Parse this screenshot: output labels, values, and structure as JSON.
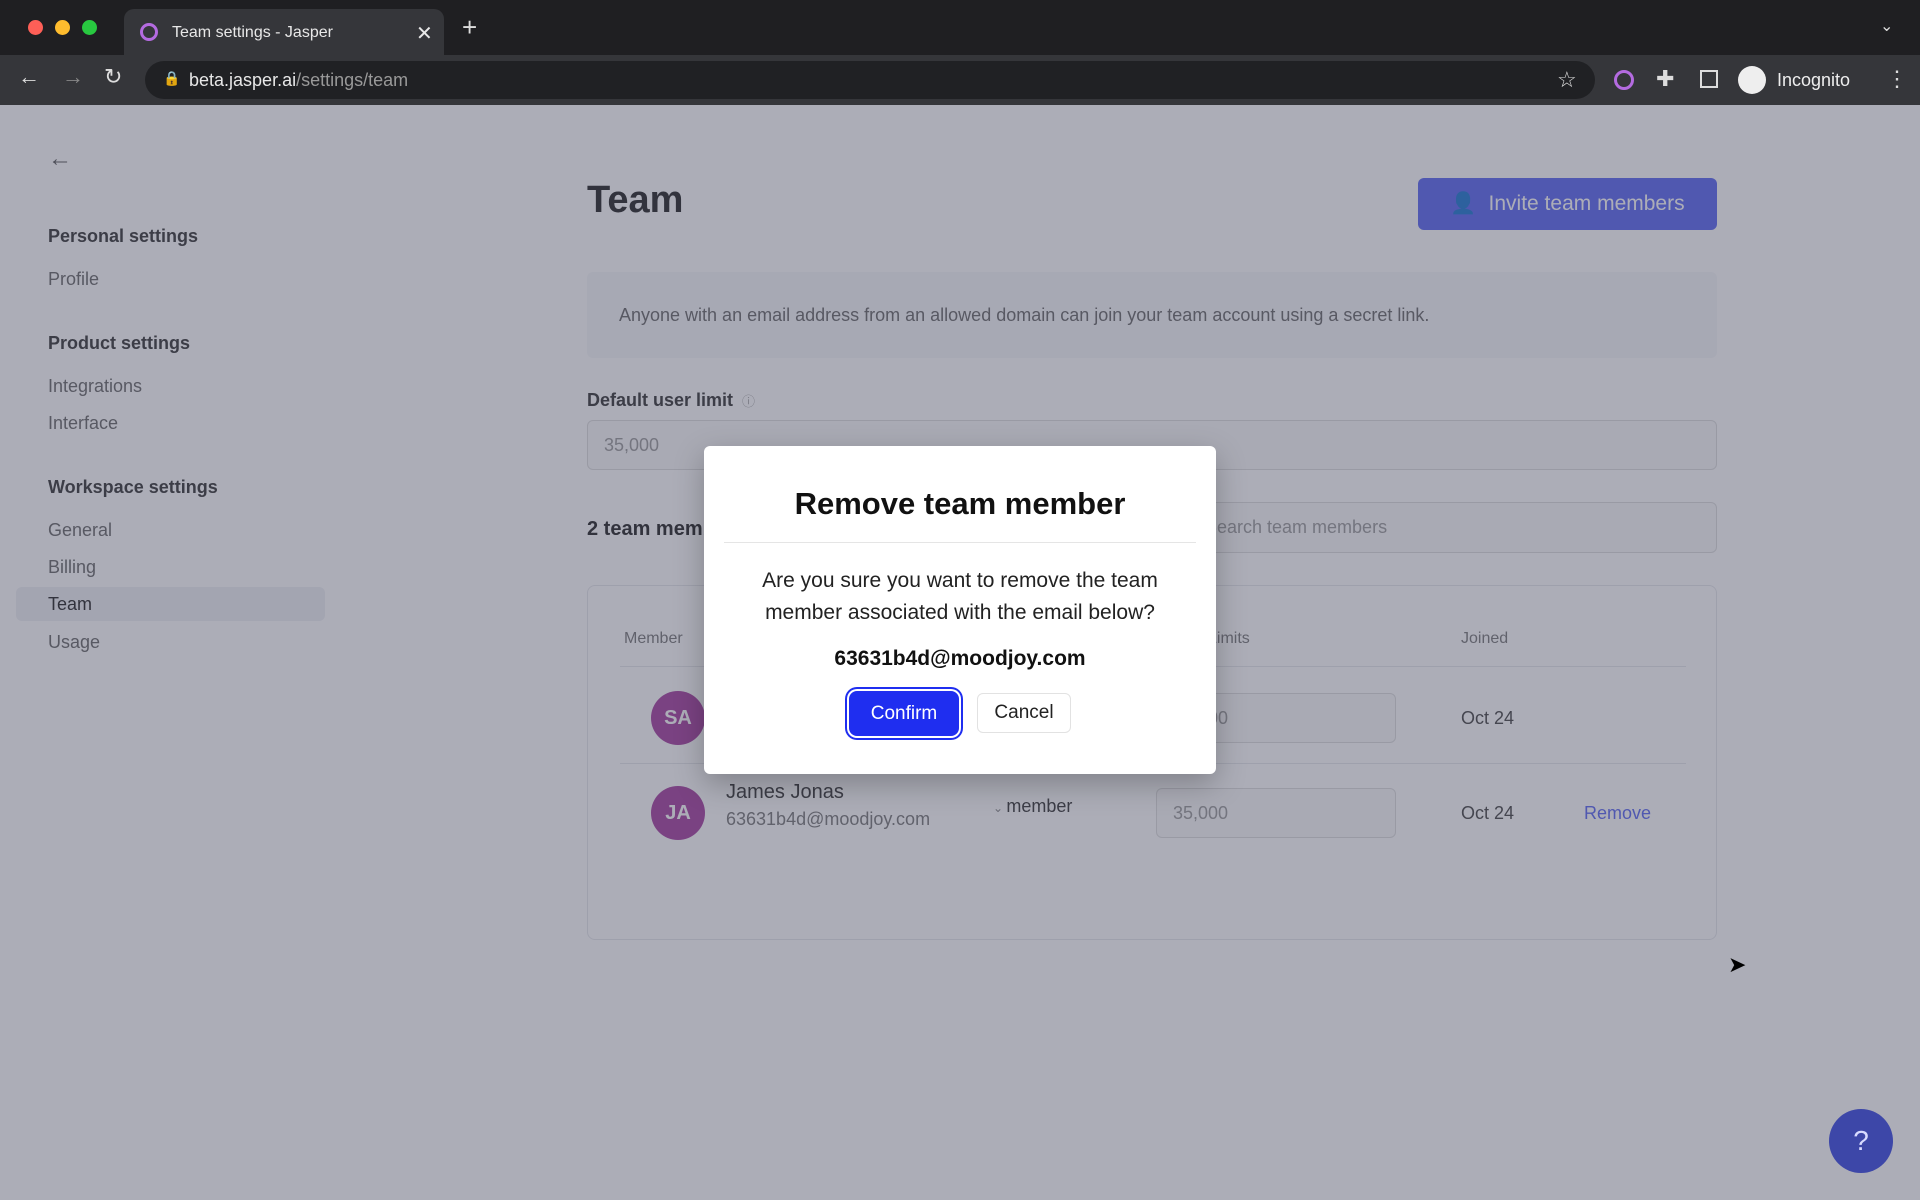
{
  "browser": {
    "tab_title": "Team settings - Jasper",
    "url_host": "beta.jasper.ai",
    "url_path": "/settings/team",
    "profile_label": "Incognito"
  },
  "sidebar": {
    "sections": [
      {
        "heading": "Personal settings",
        "items": [
          {
            "label": "Profile"
          }
        ]
      },
      {
        "heading": "Product settings",
        "items": [
          {
            "label": "Integrations"
          },
          {
            "label": "Interface"
          }
        ]
      },
      {
        "heading": "Workspace settings",
        "items": [
          {
            "label": "General"
          },
          {
            "label": "Billing"
          },
          {
            "label": "Team",
            "active": true
          },
          {
            "label": "Usage"
          }
        ]
      }
    ]
  },
  "main": {
    "title": "Team",
    "invite_label": "Invite team members",
    "info_text": "Anyone with an email address from an allowed domain can join your team account using a secret link.",
    "default_limit_label": "Default user limit",
    "default_limit_value": "35,000",
    "member_count": "2 team members",
    "search_placeholder": "Search team members",
    "columns": [
      "Member",
      "Limits",
      "Joined"
    ],
    "rows": [
      {
        "initials": "SA",
        "name": "",
        "email": "",
        "role": "",
        "limit": "35,000",
        "joined": "Oct 24",
        "action": ""
      },
      {
        "initials": "JA",
        "name": "James Jonas",
        "email": "63631b4d@moodjoy.com",
        "role": "member",
        "limit": "35,000",
        "joined": "Oct 24",
        "action": "Remove"
      }
    ]
  },
  "modal": {
    "title": "Remove team member",
    "body": "Are you sure you want to remove the team member associated with the email below?",
    "email": "63631b4d@moodjoy.com",
    "confirm": "Confirm",
    "cancel": "Cancel"
  },
  "help_label": "?",
  "colors": {
    "accent": "#5865f2",
    "confirm": "#1f2ef0",
    "avatar": "#a43d9e"
  }
}
